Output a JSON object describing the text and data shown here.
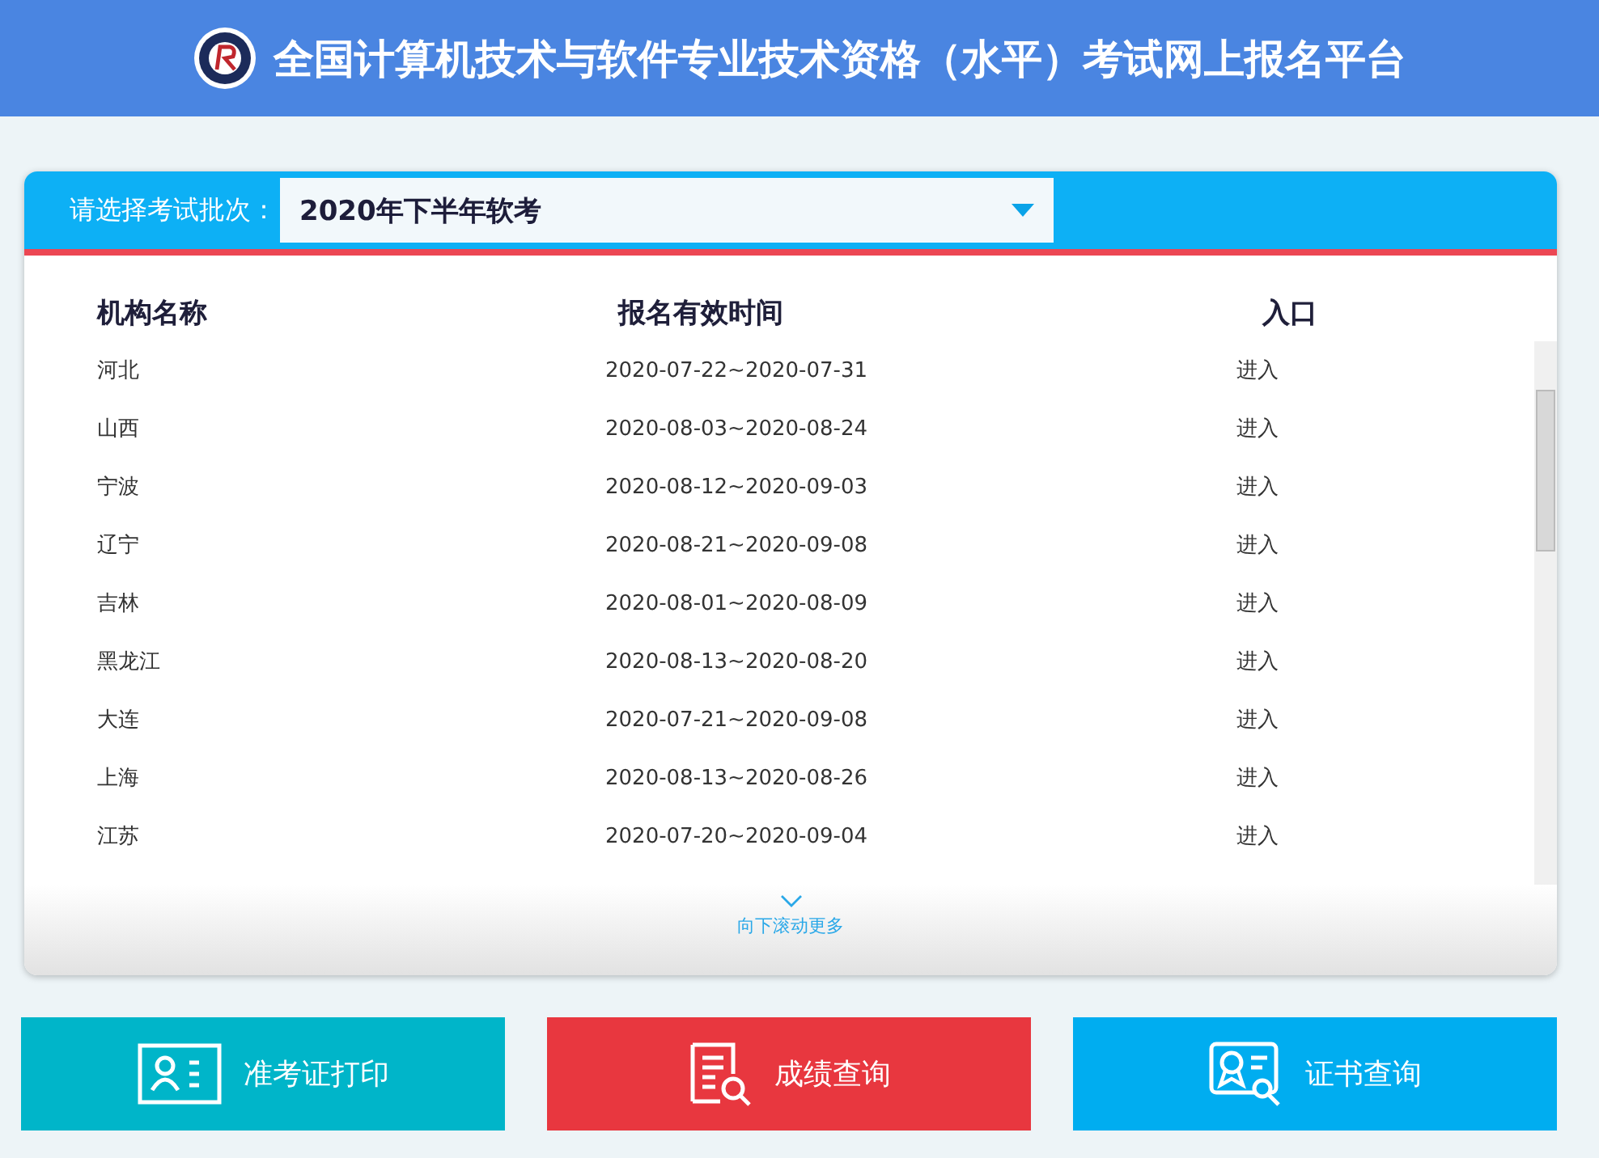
{
  "header": {
    "title": "全国计算机技术与软件专业技术资格（水平）考试网上报名平台"
  },
  "selector": {
    "label": "请选择考试批次：",
    "value": "2020年下半年软考"
  },
  "table": {
    "columns": [
      "机构名称",
      "报名有效时间",
      "入口"
    ],
    "rows": [
      {
        "name": "河北",
        "period": "2020-07-22~2020-07-31",
        "entry": "进入"
      },
      {
        "name": "山西",
        "period": "2020-08-03~2020-08-24",
        "entry": "进入"
      },
      {
        "name": "宁波",
        "period": "2020-08-12~2020-09-03",
        "entry": "进入"
      },
      {
        "name": "辽宁",
        "period": "2020-08-21~2020-09-08",
        "entry": "进入"
      },
      {
        "name": "吉林",
        "period": "2020-08-01~2020-08-09",
        "entry": "进入"
      },
      {
        "name": "黑龙江",
        "period": "2020-08-13~2020-08-20",
        "entry": "进入"
      },
      {
        "name": "大连",
        "period": "2020-07-21~2020-09-08",
        "entry": "进入"
      },
      {
        "name": "上海",
        "period": "2020-08-13~2020-08-26",
        "entry": "进入"
      },
      {
        "name": "江苏",
        "period": "2020-07-20~2020-09-04",
        "entry": "进入"
      }
    ]
  },
  "scroll_hint": "向下滚动更多",
  "actions": [
    {
      "kind": "ticket",
      "label": "准考证打印",
      "color": "#00b5c9"
    },
    {
      "kind": "score",
      "label": "成绩查询",
      "color": "#e8373f"
    },
    {
      "kind": "certificate",
      "label": "证书查询",
      "color": "#00adf0"
    }
  ]
}
